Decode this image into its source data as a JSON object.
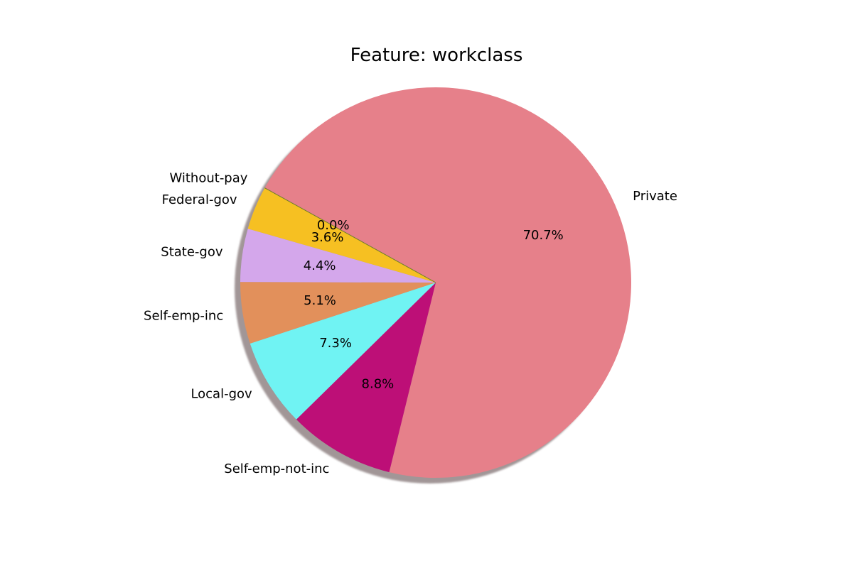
{
  "chart_data": {
    "type": "pie",
    "title": "Feature: workclass",
    "categories": [
      "Private",
      "Self-emp-not-inc",
      "Local-gov",
      "Self-emp-inc",
      "State-gov",
      "Federal-gov",
      "Without-pay"
    ],
    "values": [
      70.7,
      8.8,
      7.3,
      5.1,
      4.4,
      3.6,
      0.0
    ],
    "percent_labels": [
      "70.7%",
      "8.8%",
      "7.3%",
      "5.1%",
      "4.4%",
      "3.6%",
      "0.0%"
    ],
    "colors": [
      "#e6808a",
      "#bd0f77",
      "#70f3f3",
      "#e2905b",
      "#d4a7eb",
      "#f6c022",
      "#6b7e2b"
    ],
    "shadow": true,
    "legend": "none"
  }
}
